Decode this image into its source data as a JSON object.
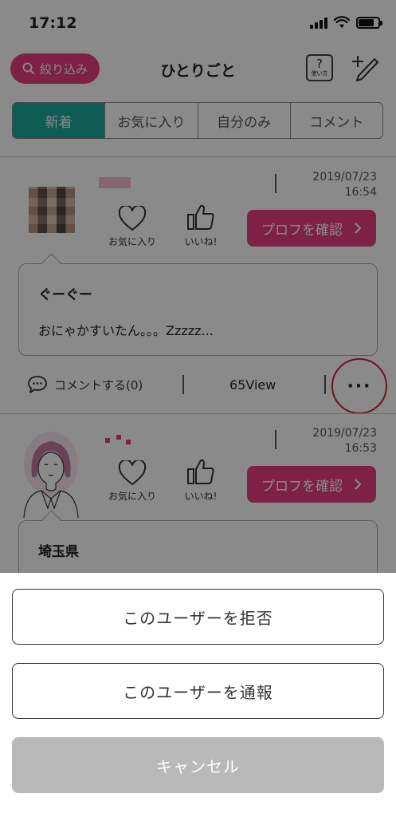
{
  "status_bar": {
    "time": "17:12"
  },
  "header": {
    "filter_label": "絞り込み",
    "title": "ひとりごと",
    "help_label": "?",
    "help_sub": "使い方"
  },
  "tabs": [
    {
      "label": "新着",
      "active": true
    },
    {
      "label": "お気に入り",
      "active": false
    },
    {
      "label": "自分のみ",
      "active": false
    },
    {
      "label": "コメント",
      "active": false
    }
  ],
  "posts": [
    {
      "date": "2019/07/23",
      "time": "16:54",
      "favorite_label": "お気に入り",
      "like_label": "いいね!",
      "profile_button": "プロフを確認",
      "title": "ぐーぐー",
      "body": "おにゃかすいたん。。。Zzzzz...",
      "comment_label": "コメントする(0)",
      "views": "65View",
      "more_label": "···"
    },
    {
      "date": "2019/07/23",
      "time": "16:53",
      "favorite_label": "お気に入り",
      "like_label": "いいね!",
      "profile_button": "プロフを確認",
      "title": "埼玉県"
    }
  ],
  "action_sheet": {
    "block_label": "このユーザーを拒否",
    "report_label": "このユーザーを通報",
    "cancel_label": "キャンセル"
  },
  "colors": {
    "accent_pink": "#e8407e",
    "accent_teal": "#1cab9b",
    "highlight_red": "#d01c3c",
    "cancel_gray": "#b9b9b9"
  }
}
